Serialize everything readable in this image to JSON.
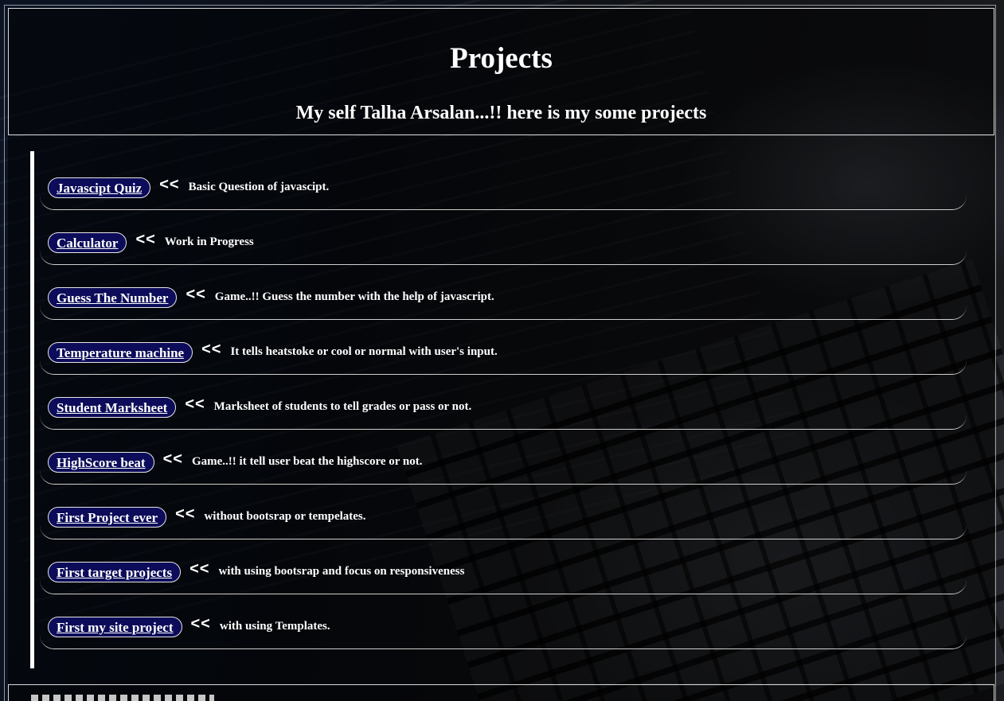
{
  "header": {
    "title": "Projects",
    "subtitle": "My self Talha Arsalan...!! here is my some projects"
  },
  "projects": [
    {
      "label": "Javascipt Quiz",
      "arrow": "<<",
      "description": "Basic Question of javascipt."
    },
    {
      "label": "Calculator",
      "arrow": "<<",
      "description": "Work in Progress"
    },
    {
      "label": "Guess The Number",
      "arrow": "<<",
      "description": "Game..!! Guess the number with the help of javascript."
    },
    {
      "label": "Temperature machine",
      "arrow": "<<",
      "description": "It tells heatstoke or cool or normal with user's input."
    },
    {
      "label": "Student Marksheet",
      "arrow": "<<",
      "description": "Marksheet of students to tell grades or pass or not."
    },
    {
      "label": "HighScore beat",
      "arrow": "<<",
      "description": "Game..!! it tell user beat the highscore or not."
    },
    {
      "label": "First Project ever",
      "arrow": "<<",
      "description": "without bootsrap or tempelates."
    },
    {
      "label": "First target projects",
      "arrow": "<<",
      "description": "with using bootsrap and focus on responsiveness"
    },
    {
      "label": "First my site project",
      "arrow": "<<",
      "description": "with using Templates."
    }
  ],
  "colors": {
    "link_background": "#0c0c5a",
    "text": "#ffffff",
    "border": "#d8d8d8"
  }
}
